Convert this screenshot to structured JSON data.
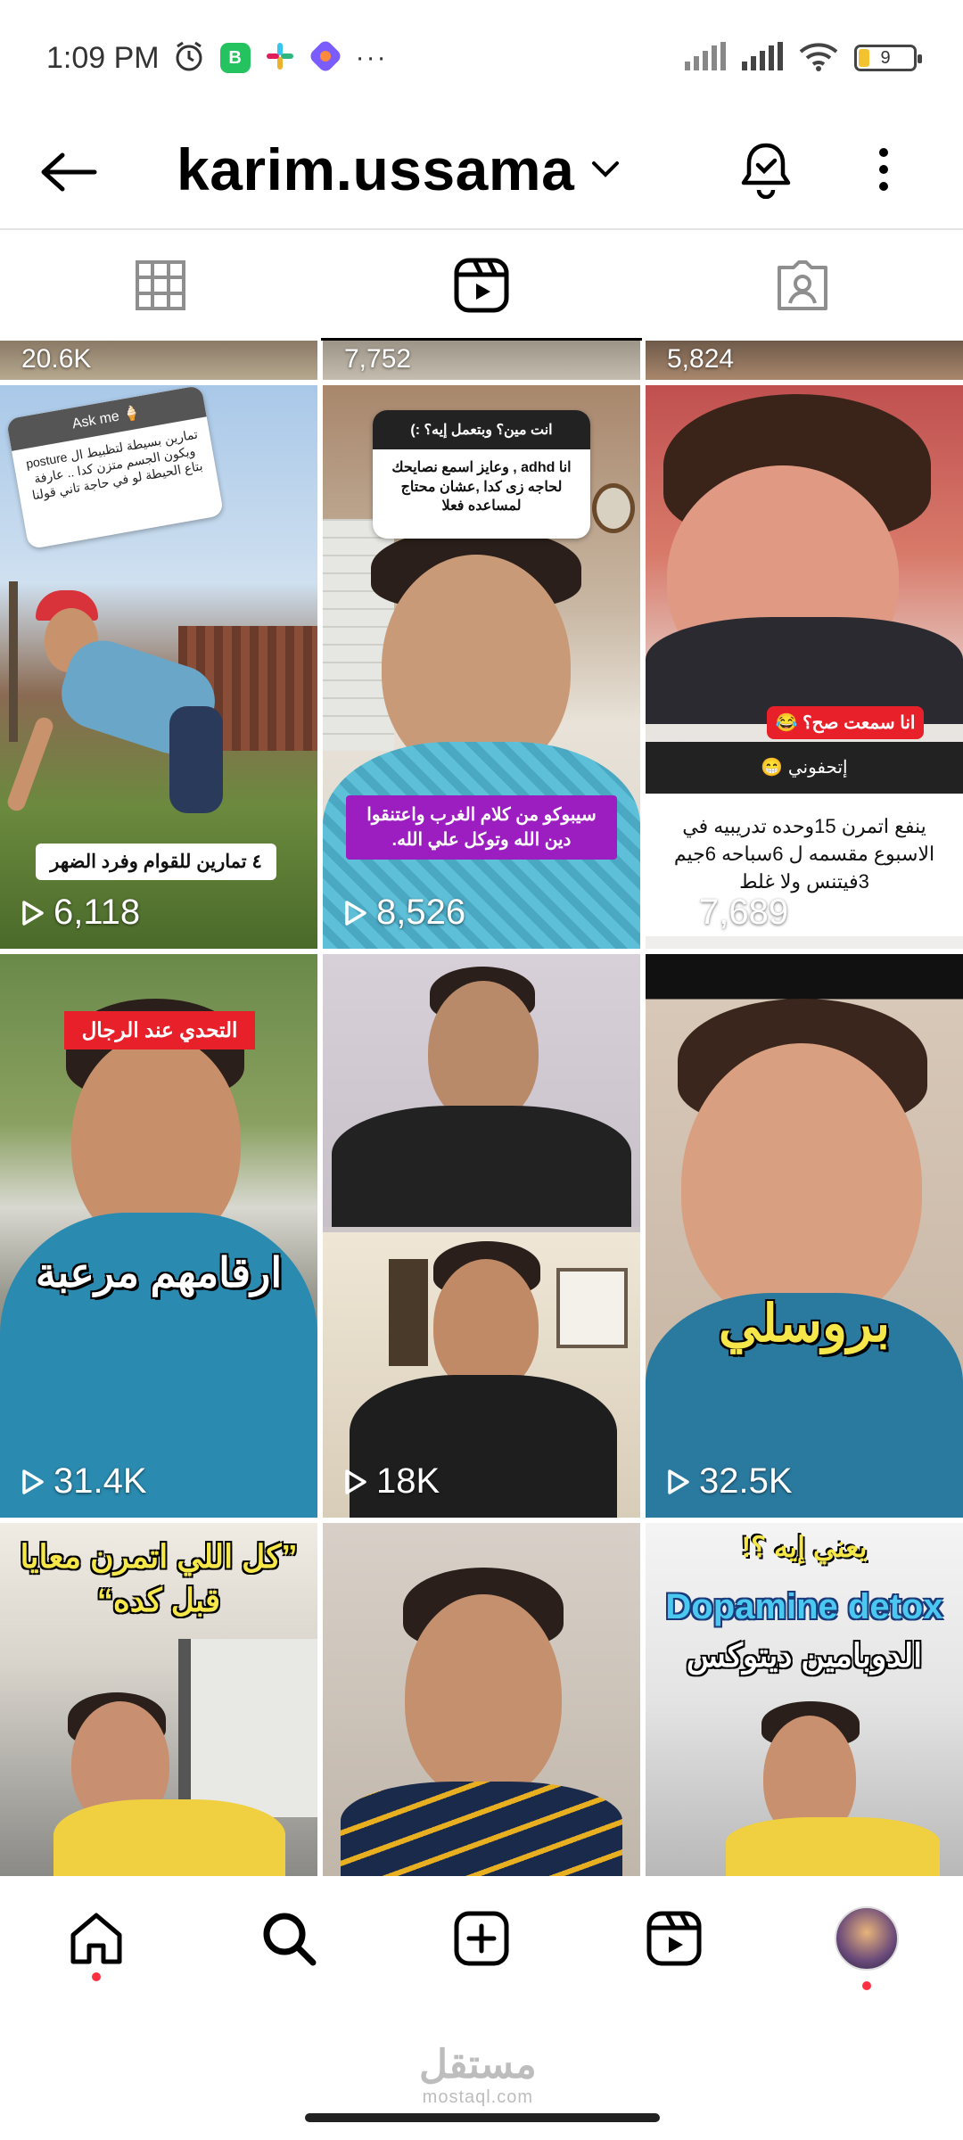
{
  "status_bar": {
    "time": "1:09 PM",
    "battery": "9",
    "icons": [
      "alarm-icon",
      "whatsapp-business-icon",
      "slack-icon",
      "app-icon",
      "more-dots-icon",
      "signal-icon",
      "signal-icon",
      "wifi-icon",
      "battery-icon"
    ]
  },
  "header": {
    "username": "karim.ussama",
    "icons": [
      "back-arrow-icon",
      "chevron-down-icon",
      "bell-icon",
      "more-vertical-icon"
    ]
  },
  "tabs": [
    {
      "name": "grid",
      "icon": "grid-icon",
      "active": false
    },
    {
      "name": "reels",
      "icon": "reels-icon",
      "active": true
    },
    {
      "name": "tagged",
      "icon": "tagged-icon",
      "active": false
    }
  ],
  "grid": {
    "top_row_partial": [
      "20.6K",
      "7,752",
      "5,824"
    ],
    "items": [
      {
        "views": "6,118",
        "box_title": "Ask me 🍦",
        "box_body": "تمارين بسيطة لتظبيط ال posture ويكون الجسم متزن كدا .. عارفة بتاع الحيطة لو في حاجة تاني قولنا",
        "caption": "٤ تمارين للقوام وفرد الضهر"
      },
      {
        "views": "8,526",
        "box_title": "انت مين؟ وبتعمل إيه؟ :)",
        "box_body": "انا adhd , وعايز اسمع نصايحك لحاجه زى كدا ,عشان محتاج لمساعده فعلا",
        "caption": "سيبوكو من كلام الغرب واعتنقوا دين الله وتوكل علي الله."
      },
      {
        "views": "7,689",
        "tag": "انا سمعت صح؟ 😂",
        "box_title": "إتحفوني 😁",
        "box_body": "ينفع اتمرن 15وحده تدريبيه في الاسبوع مقسمه ل 6سباحه 6جيم 3فيتنس ولا غلط"
      },
      {
        "views": "31.4K",
        "tag": "التحدي عند الرجال",
        "caption": "ارقامهم مرعبة"
      },
      {
        "views": "18K"
      },
      {
        "views": "32.5K",
        "caption": "بروسلي"
      },
      {
        "caption": "”كل اللي اتمرن معايا قبل كده“"
      },
      {},
      {
        "caption_top": "يعني إيه ؟!",
        "caption_en": "Dopamine detox",
        "caption_ar": "الدوبامين ديتوكس"
      }
    ]
  },
  "bottom_nav": {
    "items": [
      "home-icon",
      "search-icon",
      "create-icon",
      "reels-icon",
      "profile-avatar"
    ]
  },
  "watermark": {
    "arabic": "مستقل",
    "latin": "mostaql.com"
  },
  "colors": {
    "accent_red": "#ff3040",
    "tag_red": "#e8202a",
    "tag_purple": "#a020c8",
    "caption_yellow": "#f5e64a"
  }
}
